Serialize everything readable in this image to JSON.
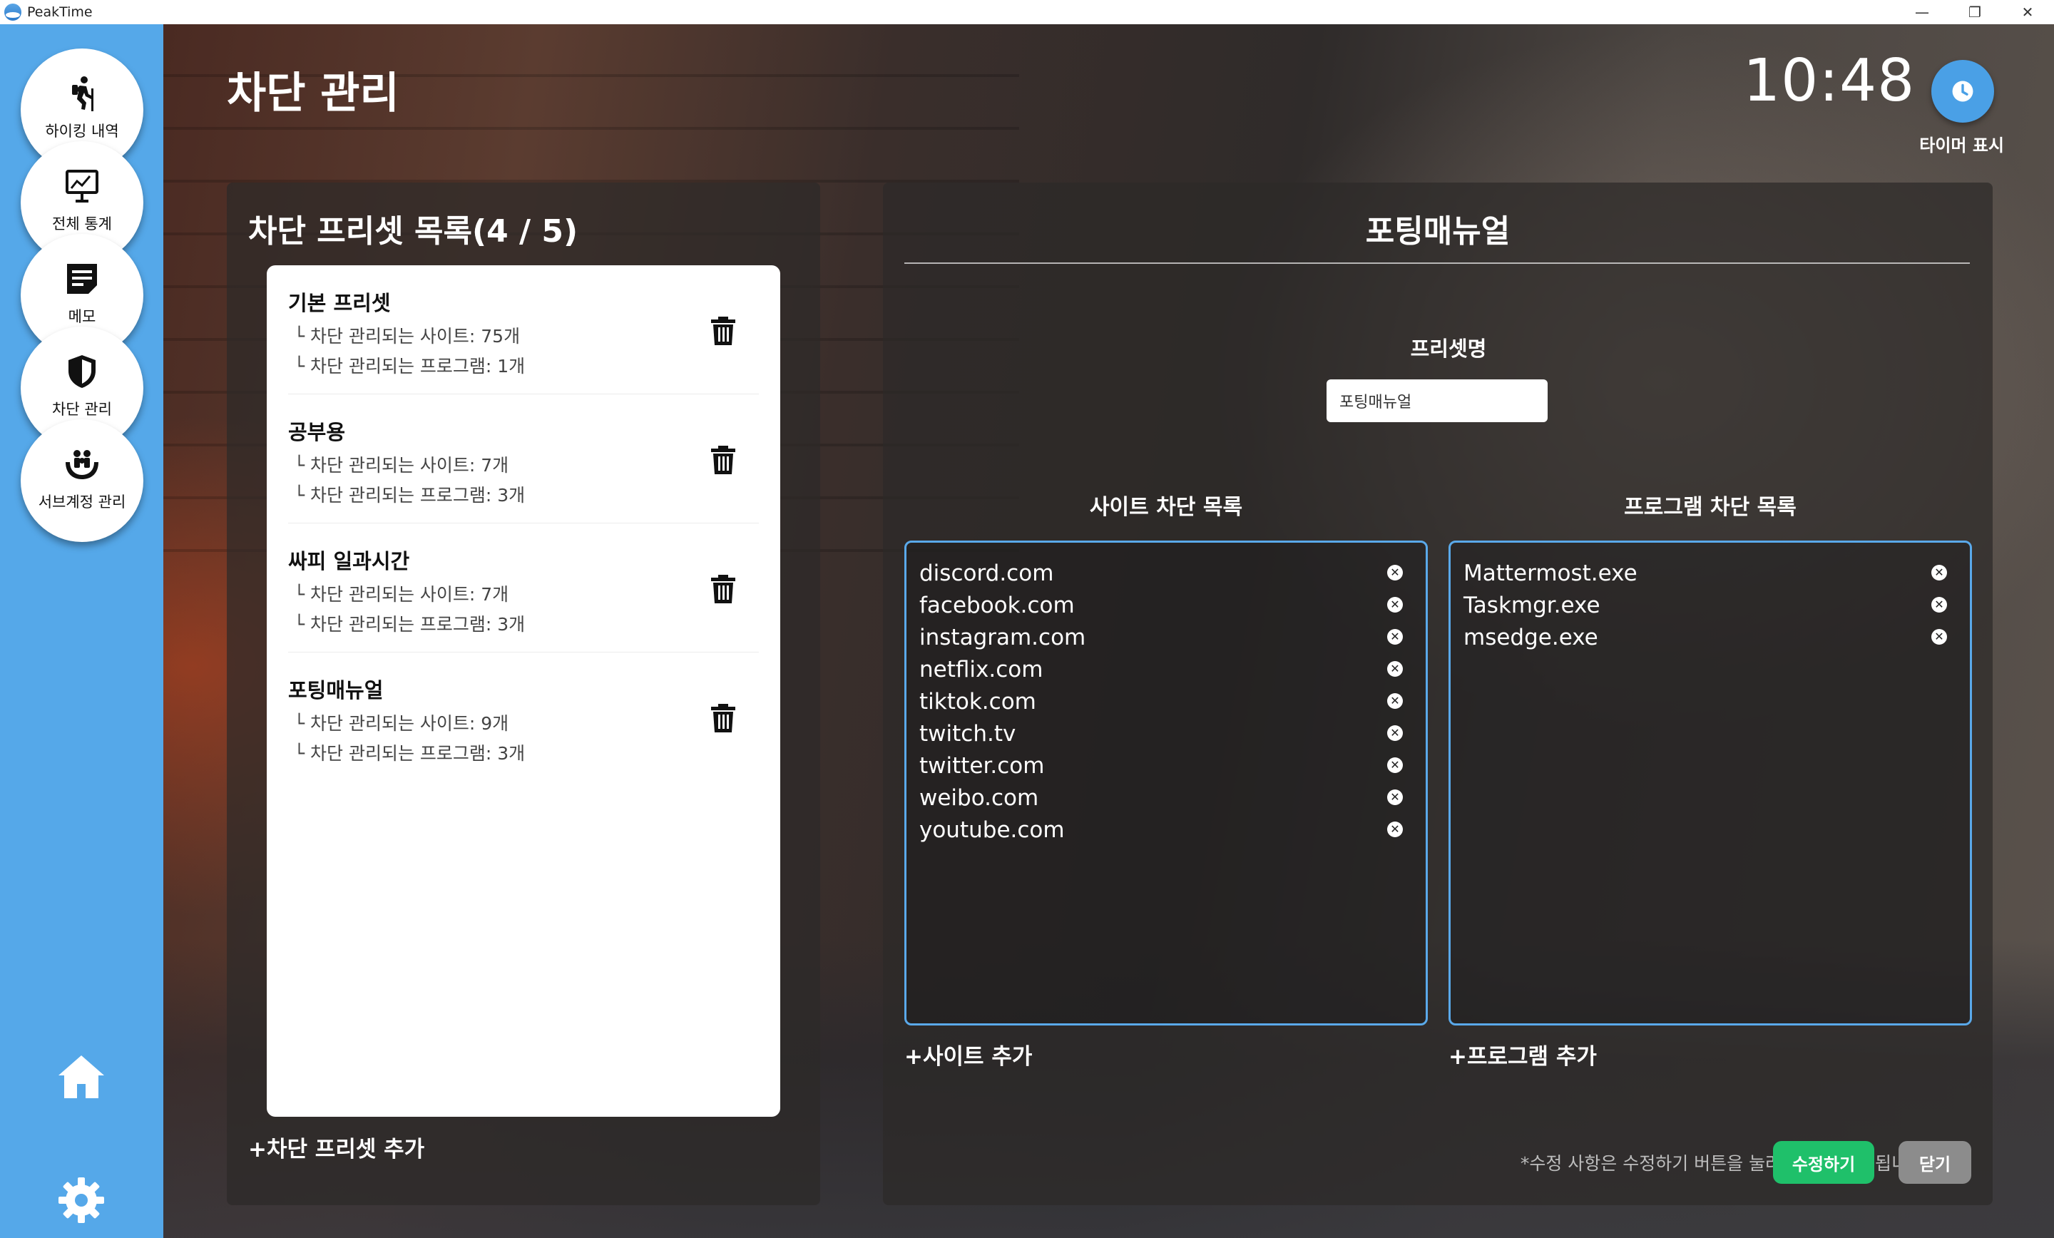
{
  "window": {
    "app_name": "PeakTime",
    "controls": [
      "—",
      "❐",
      "✕"
    ]
  },
  "sidebar": {
    "items": [
      {
        "label": "하이킹 내역",
        "icon": "hiker-icon"
      },
      {
        "label": "전체 통계",
        "icon": "chart-board-icon"
      },
      {
        "label": "메모",
        "icon": "memo-icon"
      },
      {
        "label": "차단 관리",
        "icon": "shield-icon"
      },
      {
        "label": "서브계정 관리",
        "icon": "family-hands-icon"
      }
    ],
    "bottom_icons": [
      "home-icon",
      "gear-icon"
    ],
    "color": "#55a8e9"
  },
  "header": {
    "page_title": "차단 관리",
    "clock": "10:48",
    "timer_label": "타이머 표시"
  },
  "preset_panel": {
    "title": "차단 프리셋 목록(4 / 5)",
    "presets": [
      {
        "name": "기본 프리셋",
        "sites": "└ 차단 관리되는 사이트: 75개",
        "programs": "└ 차단 관리되는 프로그램: 1개"
      },
      {
        "name": "공부용",
        "sites": "└ 차단 관리되는 사이트: 7개",
        "programs": "└ 차단 관리되는 프로그램: 3개"
      },
      {
        "name": "싸피 일과시간",
        "sites": "└ 차단 관리되는 사이트: 7개",
        "programs": "└ 차단 관리되는 프로그램: 3개"
      },
      {
        "name": "포팅매뉴얼",
        "sites": "└ 차단 관리되는 사이트: 9개",
        "programs": "└ 차단 관리되는 프로그램: 3개"
      }
    ],
    "add_label": "+차단 프리셋 추가"
  },
  "detail_panel": {
    "title": "포팅매뉴얼",
    "preset_name_label": "프리셋명",
    "preset_name_value": "포팅매뉴얼",
    "site_list_label": "사이트 차단 목록",
    "program_list_label": "프로그램 차단 목록",
    "sites": [
      "discord.com",
      "facebook.com",
      "instagram.com",
      "netflix.com",
      "tiktok.com",
      "twitch.tv",
      "twitter.com",
      "weibo.com",
      "youtube.com"
    ],
    "programs": [
      "Mattermost.exe",
      "Taskmgr.exe",
      "msedge.exe"
    ],
    "add_site_label": "+사이트 추가",
    "add_program_label": "+프로그램 추가",
    "notice": "*수정 사항은 수정하기 버튼을 눌러야 최종 반영됩니다",
    "edit_button": "수정하기",
    "close_button": "닫기",
    "accent_color": "#5aa9ea",
    "edit_color": "#1fc06a"
  }
}
